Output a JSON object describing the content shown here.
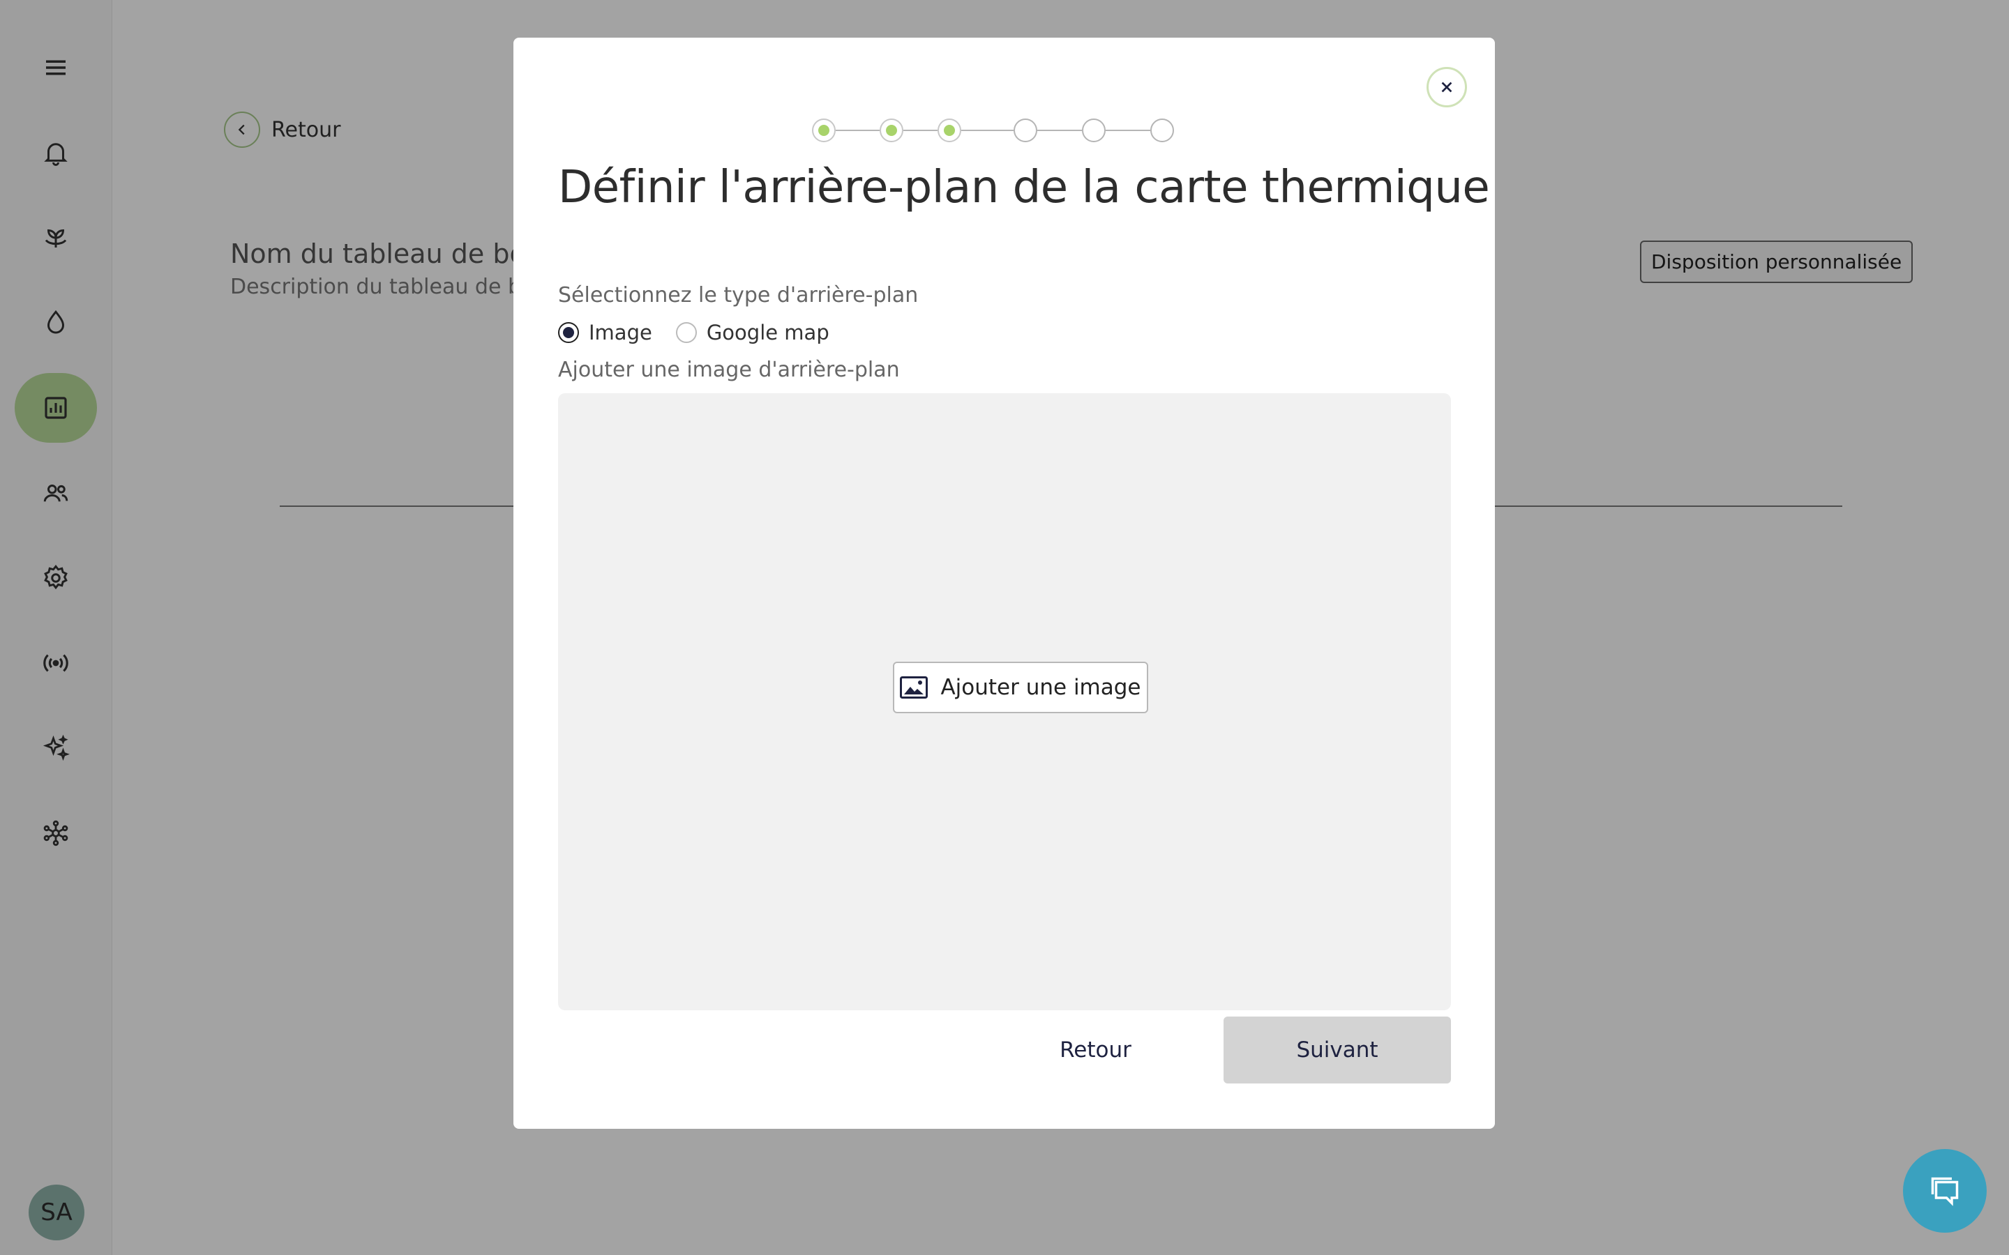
{
  "page": {
    "back_label": "Retour",
    "dashboard_name": "Nom du tableau de bord",
    "dashboard_description": "Description du tableau de bord",
    "layout_button": "Disposition personnalisée"
  },
  "sidebar": {
    "items": [
      {
        "name": "menu-icon"
      },
      {
        "name": "bell-icon"
      },
      {
        "name": "plant-icon"
      },
      {
        "name": "water-drop-icon"
      },
      {
        "name": "chart-icon",
        "active": true
      },
      {
        "name": "users-icon"
      },
      {
        "name": "gear-icon"
      },
      {
        "name": "broadcast-icon"
      },
      {
        "name": "sparkles-icon"
      },
      {
        "name": "network-icon"
      }
    ],
    "avatar_initials": "SA",
    "active_color": "#b8d99a"
  },
  "modal": {
    "steps_total": 6,
    "steps_completed": 3,
    "title": "Définir l'arrière-plan de la carte thermique",
    "background_type_label": "Sélectionnez le type d'arrière-plan",
    "options": [
      {
        "label": "Image",
        "checked": true
      },
      {
        "label": "Google map",
        "checked": false
      }
    ],
    "add_background_label": "Ajouter une image d'arrière-plan",
    "add_image_button": "Ajouter une image",
    "back_button": "Retour",
    "next_button": "Suivant"
  },
  "colors": {
    "accent_green": "#a8d36a",
    "chat_fab": "#3aa1bf",
    "dark_navy": "#1e2240"
  }
}
